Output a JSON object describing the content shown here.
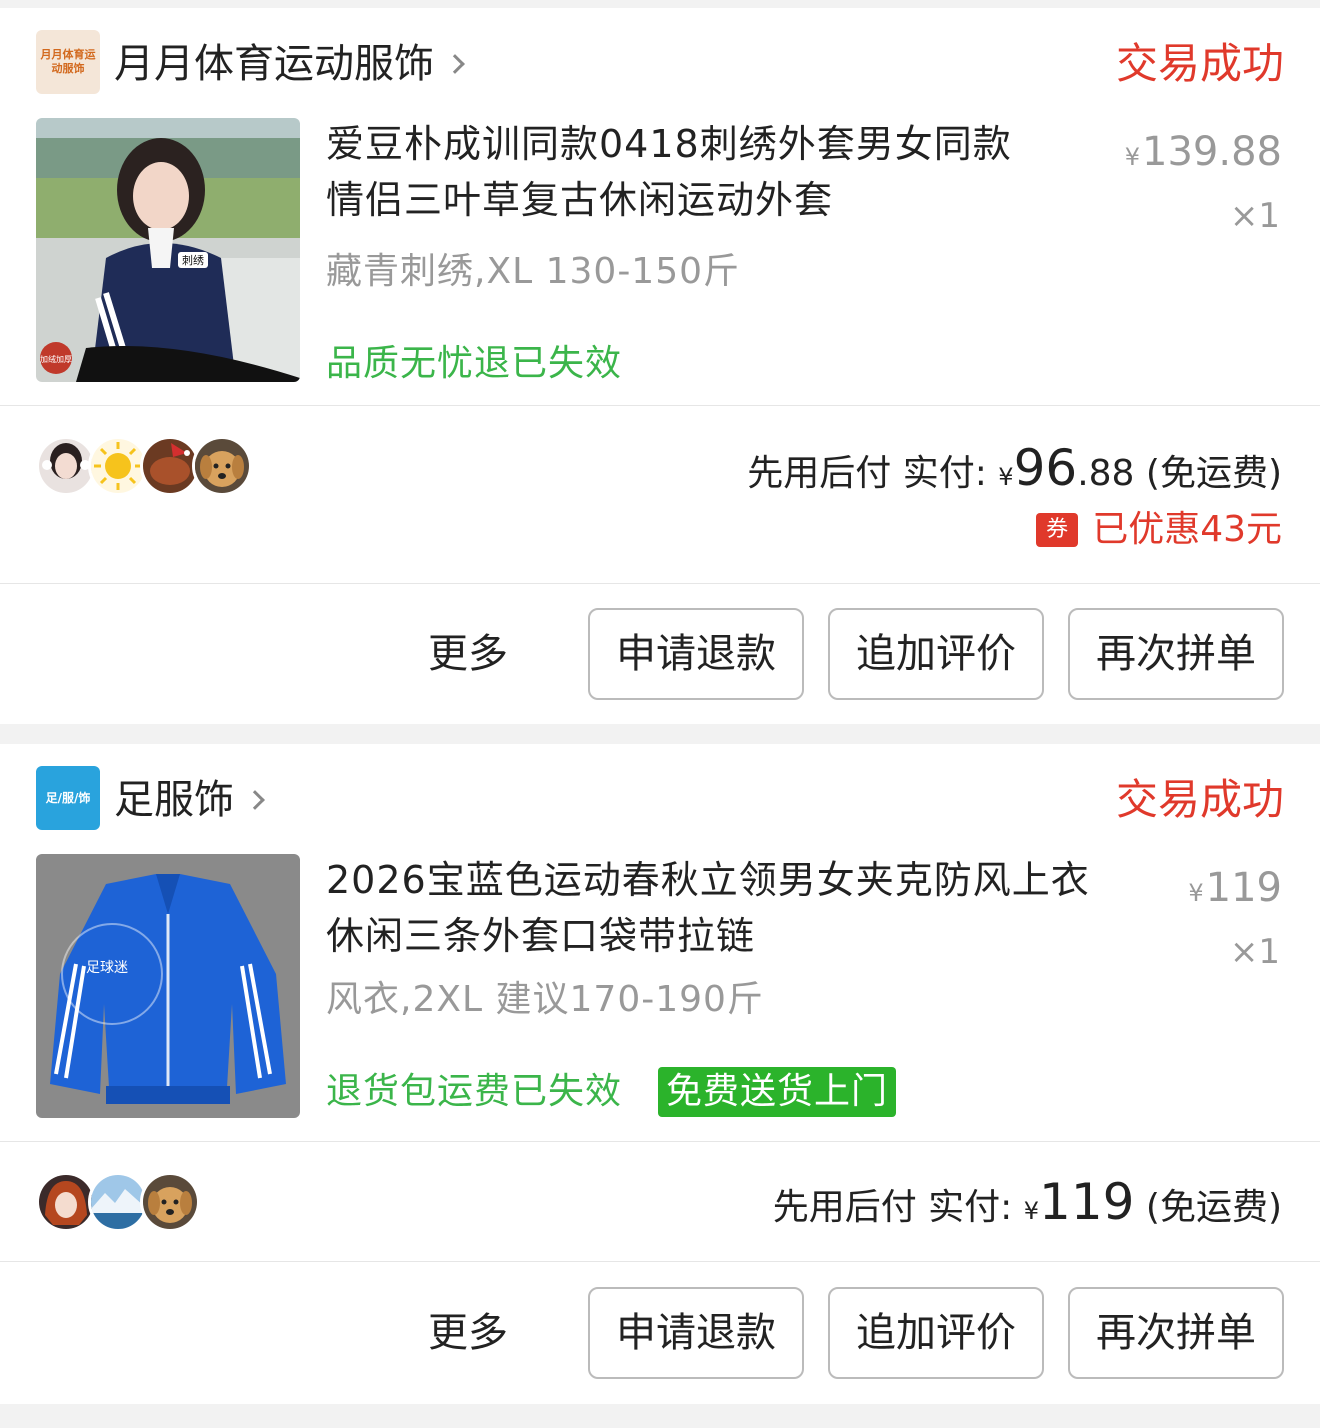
{
  "orders": [
    {
      "shop": {
        "name": "月月体育运动服饰",
        "logo_text": "月月体育运动服饰"
      },
      "status": "交易成功",
      "product": {
        "title_line1": "爱豆朴成训同款0418刺绣外套男女同款",
        "title_line2": "情侣三叶草复古休闲运动外套",
        "spec": "藏青刺绣,XL 130-150斤",
        "service_tag": "品质无忧退已失效",
        "price_symbol": "¥",
        "price": "139.88",
        "quantity": "×1",
        "image_label": "刺绣",
        "image_badge": "加绒加厚"
      },
      "payment": {
        "label": "先用后付 实付:",
        "symbol": "¥",
        "amount_int": "96",
        "amount_dec": ".88",
        "shipping": "(免运费)",
        "coupon_icon": "券",
        "discount": "已优惠43元"
      },
      "actions": {
        "more": "更多",
        "refund": "申请退款",
        "review": "追加评价",
        "reorder": "再次拼单"
      }
    },
    {
      "shop": {
        "name": "足服饰",
        "logo_text": "足/服/饰"
      },
      "status": "交易成功",
      "product": {
        "title_line1": "2026宝蓝色运动春秋立领男女夹克防风上衣",
        "title_line2": "休闲三条外套口袋带拉链",
        "spec": "风衣,2XL 建议170-190斤",
        "service_tag": "退货包运费已失效",
        "badge": "免费送货上门",
        "price_symbol": "¥",
        "price": "119",
        "quantity": "×1",
        "image_label": "足球迷"
      },
      "payment": {
        "label": "先用后付 实付:",
        "symbol": "¥",
        "amount_int": "119",
        "amount_dec": "",
        "shipping": "(免运费)"
      },
      "actions": {
        "more": "更多",
        "refund": "申请退款",
        "review": "追加评价",
        "reorder": "再次拼单"
      }
    }
  ],
  "colors": {
    "status_red": "#e0392b",
    "service_green": "#3bb54a",
    "badge_green": "#2bb32b",
    "muted": "#999999"
  }
}
